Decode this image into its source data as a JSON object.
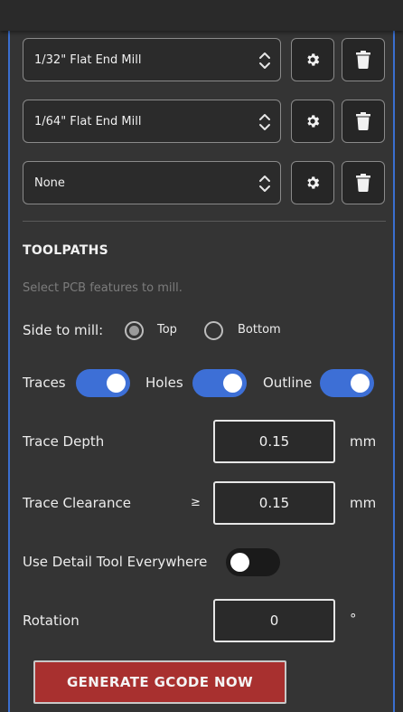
{
  "tools": [
    {
      "name": "1/32\" Flat End Mill"
    },
    {
      "name": "1/64\" Flat End Mill"
    },
    {
      "name": "None"
    }
  ],
  "toolpaths": {
    "heading": "TOOLPATHS",
    "hint": "Select PCB features to mill.",
    "side_label": "Side to mill:",
    "side_options": [
      {
        "label": "Top",
        "selected": true
      },
      {
        "label": "Bottom",
        "selected": false
      }
    ],
    "features": [
      {
        "label": "Traces",
        "enabled": true
      },
      {
        "label": "Holes",
        "enabled": true
      },
      {
        "label": "Outline",
        "enabled": true
      }
    ],
    "trace_depth": {
      "label": "Trace Depth",
      "value": "0.15",
      "unit": "mm"
    },
    "trace_clearance": {
      "label": "Trace Clearance",
      "comparator": "≥",
      "value": "0.15",
      "unit": "mm"
    },
    "detail_tool": {
      "label": "Use Detail Tool Everywhere",
      "enabled": false
    },
    "rotation": {
      "label": "Rotation",
      "value": "0",
      "unit": "°"
    }
  },
  "generate_button": "GENERATE GCODE NOW",
  "colors": {
    "accent": "#3d6fd6",
    "generate": "#a8302f",
    "panel_border": "#3a6fd0"
  }
}
